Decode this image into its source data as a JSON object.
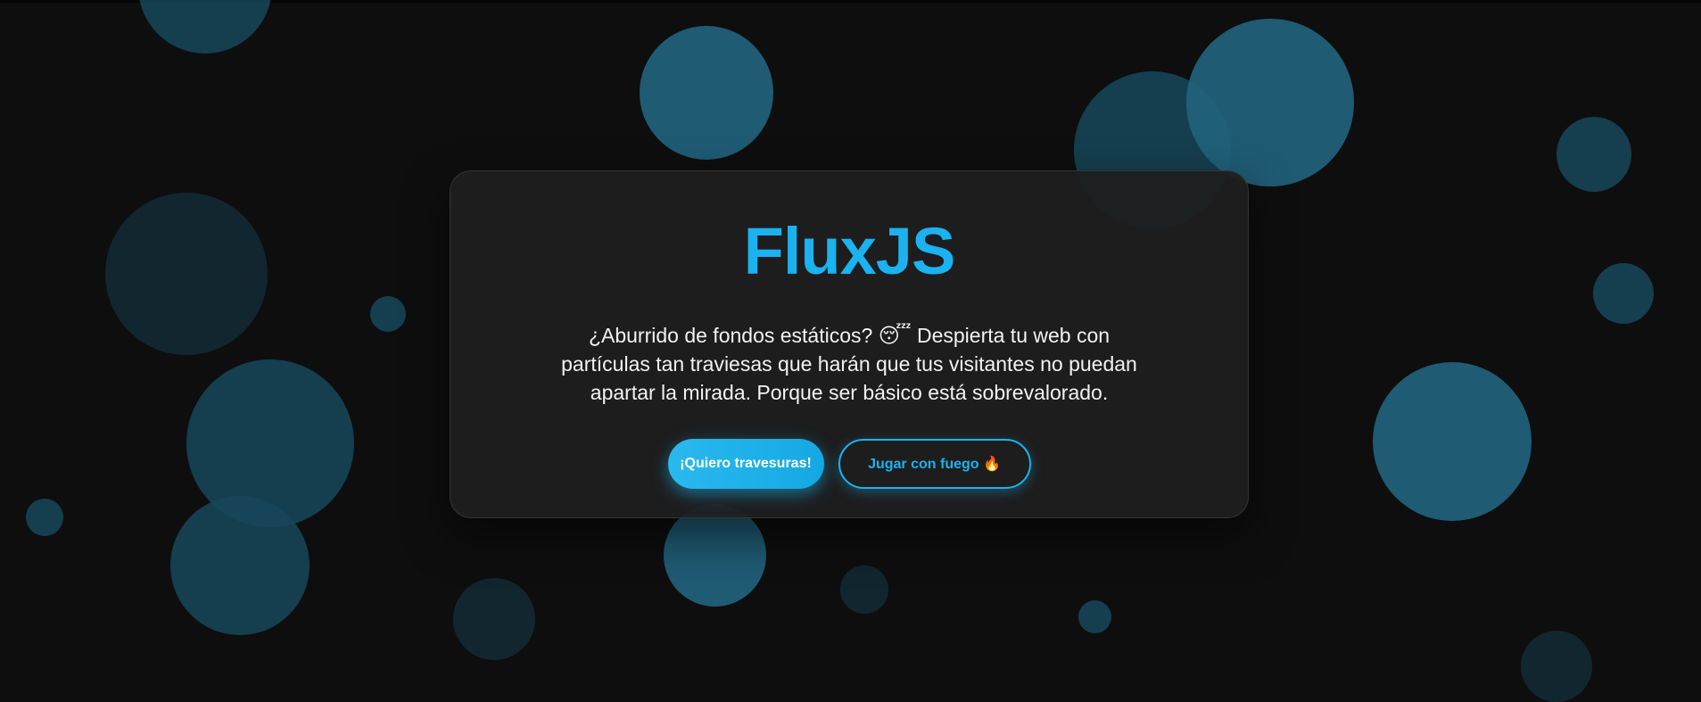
{
  "hero": {
    "title": "FluxJS",
    "description": "¿Aburrido de fondos estáticos? 😴 Despierta tu web con partículas tan traviesas que harán que tus visitantes no puedan apartar la mirada. Porque ser básico está sobrevalorado."
  },
  "actions": {
    "primary_label": "¡Quiero travesuras!",
    "secondary_label": "Jugar con fuego 🔥"
  },
  "colors": {
    "accent": "#1ab2ef",
    "background": "#0e0e0e",
    "card": "#1e1e1e",
    "particle": "#21627c"
  }
}
